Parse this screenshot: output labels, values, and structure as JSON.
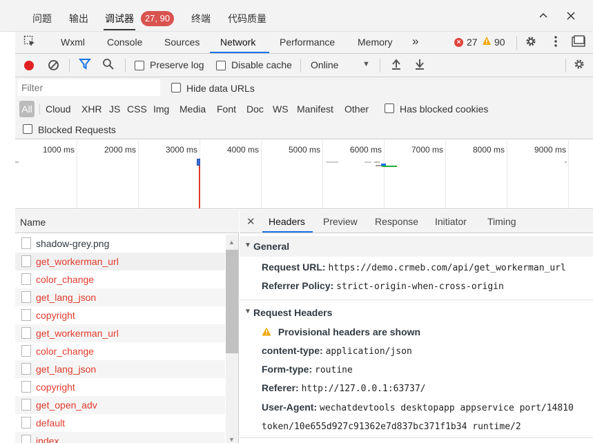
{
  "top_tabs": {
    "problems": "问题",
    "output": "输出",
    "debugger": "调试器",
    "debugger_badge": "27, 90",
    "terminal": "终端",
    "code_quality": "代码质量",
    "collapse_icon": "chevron-up-icon",
    "close_icon": "close-icon"
  },
  "panel_tabs": {
    "items": [
      "Wxml",
      "Console",
      "Sources",
      "Network",
      "Performance",
      "Memory"
    ],
    "active": "Network",
    "more": "»",
    "error_count": "27",
    "warning_count": "90"
  },
  "toolbar": {
    "preserve_log": "Preserve log",
    "disable_cache": "Disable cache",
    "throttling": "Online"
  },
  "filter": {
    "placeholder": "Filter",
    "hide_data_urls": "Hide data URLs",
    "types": [
      "All",
      "Cloud",
      "XHR",
      "JS",
      "CSS",
      "Img",
      "Media",
      "Font",
      "Doc",
      "WS",
      "Manifest",
      "Other"
    ],
    "has_blocked_cookies": "Has blocked cookies",
    "blocked_requests": "Blocked Requests"
  },
  "overview": {
    "ticks": [
      "1000 ms",
      "2000 ms",
      "3000 ms",
      "4000 ms",
      "5000 ms",
      "6000 ms",
      "7000 ms",
      "8000 ms",
      "9000 ms"
    ]
  },
  "list": {
    "header": "Name",
    "rows": [
      {
        "name": "shadow-grey.png",
        "color": "#303942"
      },
      {
        "name": "get_workerman_url",
        "color": "#e0392b"
      },
      {
        "name": "color_change",
        "color": "#e0392b"
      },
      {
        "name": "get_lang_json",
        "color": "#e0392b"
      },
      {
        "name": "copyright",
        "color": "#e0392b"
      },
      {
        "name": "get_workerman_url",
        "color": "#e0392b"
      },
      {
        "name": "color_change",
        "color": "#e0392b"
      },
      {
        "name": "get_lang_json",
        "color": "#e0392b"
      },
      {
        "name": "copyright",
        "color": "#e0392b"
      },
      {
        "name": "get_open_adv",
        "color": "#e0392b"
      },
      {
        "name": "default",
        "color": "#e0392b"
      },
      {
        "name": "index",
        "color": "#e0392b"
      }
    ]
  },
  "details": {
    "tabs": [
      "Headers",
      "Preview",
      "Response",
      "Initiator",
      "Timing"
    ],
    "active_tab": "Headers",
    "general": {
      "title": "General",
      "request_url_key": "Request URL:",
      "request_url": "https://demo.crmeb.com/api/get_workerman_url",
      "referrer_policy_key": "Referrer Policy:",
      "referrer_policy": "strict-origin-when-cross-origin"
    },
    "request_headers": {
      "title": "Request Headers",
      "provisional": "Provisional headers are shown",
      "content_type_key": "content-type:",
      "content_type": "application/json",
      "form_type_key": "Form-type:",
      "form_type": "routine",
      "referer_key": "Referer:",
      "referer": "http://127.0.0.1:63737/",
      "user_agent_key": "User-Agent:",
      "user_agent": "wechatdevtools desktopapp appservice port/14810",
      "user_agent_cont": "token/10e655d927c91362e7d837bc371f1b34 runtime/2"
    }
  },
  "colors": {
    "accent": "#1a73e8",
    "error": "#e0392b",
    "record": "#e0201f",
    "badge": "#d9534f"
  }
}
